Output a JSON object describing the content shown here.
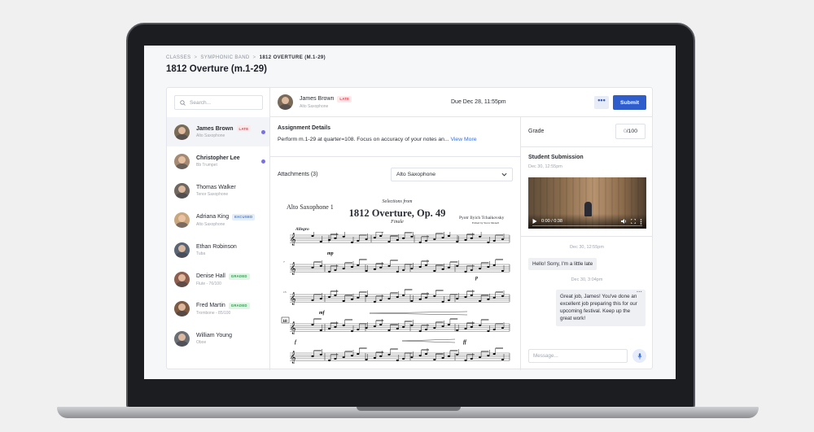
{
  "breadcrumb": {
    "items": [
      "CLASSES",
      "SYMPHONIC BAND"
    ],
    "current": "1812 OVERTURE (M.1-29)",
    "separator": ">"
  },
  "page_title": "1812 Overture (m.1-29)",
  "search": {
    "placeholder": "Search..."
  },
  "students": [
    {
      "name": "James Brown",
      "instrument": "Alto Saxophone",
      "badge": "LATE",
      "badge_type": "late",
      "unread": true,
      "avatar_color": "#7a6a58"
    },
    {
      "name": "Christopher Lee",
      "instrument": "Bb Trumpet",
      "badge": "",
      "badge_type": "",
      "unread": true,
      "avatar_color": "#a58a73"
    },
    {
      "name": "Thomas Walker",
      "instrument": "Tenor Saxophone",
      "badge": "",
      "badge_type": "",
      "unread": false,
      "avatar_color": "#6f6660"
    },
    {
      "name": "Adriana King",
      "instrument": "Alto Saxophone",
      "badge": "EXCUSED",
      "badge_type": "excused",
      "unread": false,
      "avatar_color": "#c9a77e"
    },
    {
      "name": "Ethan Robinson",
      "instrument": "Tuba",
      "badge": "",
      "badge_type": "",
      "unread": false,
      "avatar_color": "#5a6473"
    },
    {
      "name": "Denise Hall",
      "instrument": "Flute - 76/100",
      "badge": "GRADED",
      "badge_type": "graded",
      "unread": false,
      "avatar_color": "#8b5e4d"
    },
    {
      "name": "Fred Martin",
      "instrument": "Trombone - 85/100",
      "badge": "GRADED",
      "badge_type": "graded",
      "unread": false,
      "avatar_color": "#7d5a44"
    },
    {
      "name": "William Young",
      "instrument": "Oboe",
      "badge": "",
      "badge_type": "",
      "unread": false,
      "avatar_color": "#6b6e72"
    }
  ],
  "header": {
    "student_name": "James Brown",
    "student_instrument": "Alto Saxophone",
    "badge": "LATE",
    "due": "Due Dec 28, 11:55pm",
    "more_label": "•••",
    "submit_label": "Submit"
  },
  "assignment": {
    "title": "Assignment Details",
    "text": "Perform m.1-29 at quarter=108. Focus on accuracy of your notes an...",
    "view_more": "View More"
  },
  "attachments": {
    "label": "Attachments (3)",
    "selected": "Alto Saxophone"
  },
  "sheet": {
    "part": "Alto Saxophone 1",
    "subtitle": "Selections from",
    "title": "1812 Overture, Op. 49",
    "finale": "Finale",
    "composer": "Pyotr Ilyich Tchaikovsky",
    "editor": "Edited by Steve Menell",
    "tempo": "Allegro",
    "dynamics": [
      "mp",
      "p",
      "mf",
      "f",
      "ff"
    ],
    "rehearsal_mark": "18",
    "measure_numbers": [
      "7",
      "13",
      "21"
    ]
  },
  "grade": {
    "label": "Grade",
    "value": "0",
    "max": "/100"
  },
  "submission": {
    "title": "Student Submission",
    "date": "Dec 30, 12:55pm",
    "video_time": "0:00 / 0:38",
    "video_progress": 0
  },
  "messages": [
    {
      "date": "Dec 30, 12:55pm",
      "text": "Hello! Sorry, I'm a little late"
    },
    {
      "date": "Dec 30, 3:04pm",
      "text": "Great job, James! You've done an excellent job preparing this for our upcoming festival. Keep up the great work!"
    }
  ],
  "message_input": {
    "placeholder": "Message..."
  }
}
